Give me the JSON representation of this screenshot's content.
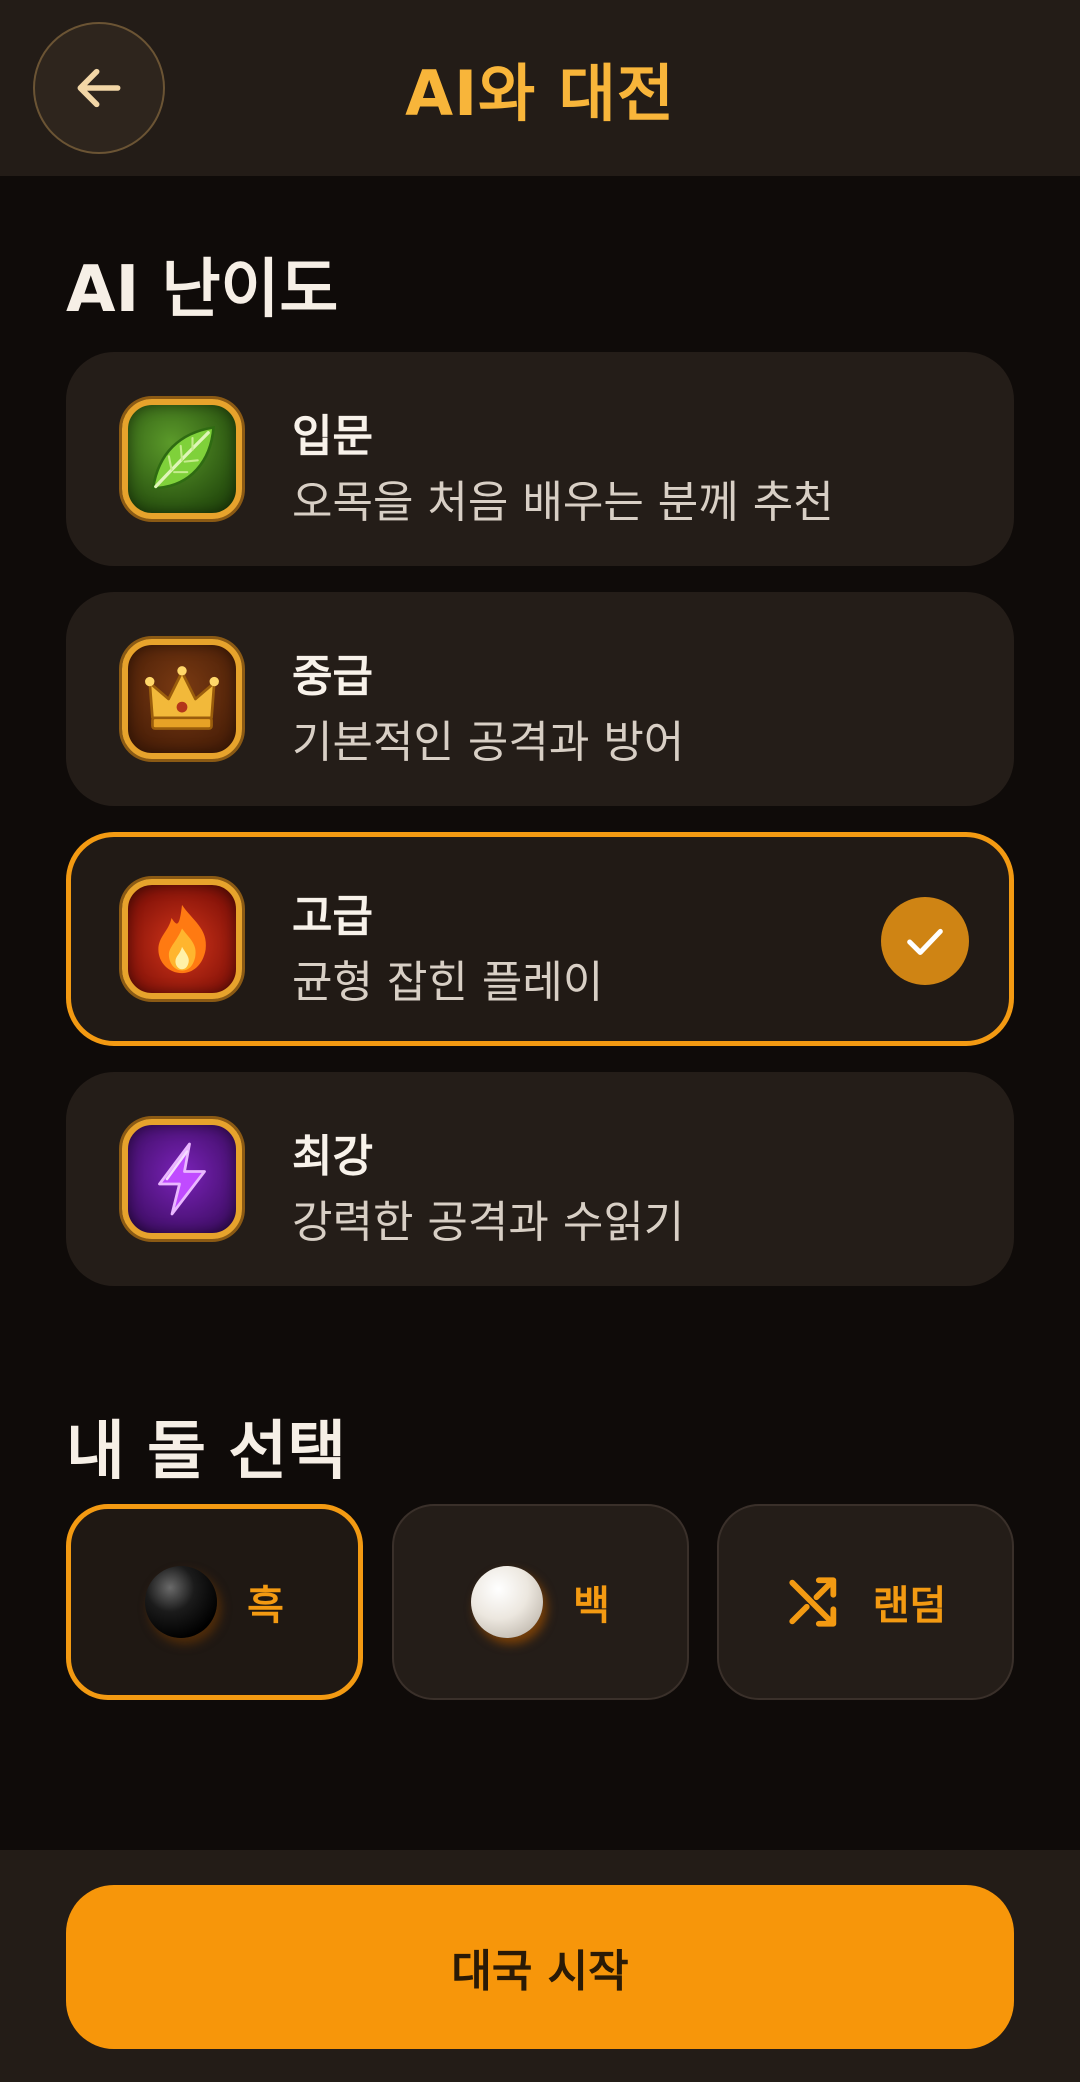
{
  "header": {
    "title": "AI와 대전",
    "back_icon": "arrow-left-icon"
  },
  "difficulty": {
    "section_title": "AI 난이도",
    "options": [
      {
        "title": "입문",
        "desc": "오목을 처음 배우는 분께 추천",
        "icon": "leaf-icon",
        "selected": false
      },
      {
        "title": "중급",
        "desc": "기본적인 공격과 방어",
        "icon": "crown-icon",
        "selected": false
      },
      {
        "title": "고급",
        "desc": "균형 잡힌 플레이",
        "icon": "flame-icon",
        "selected": true
      },
      {
        "title": "최강",
        "desc": "강력한 공격과 수읽기",
        "icon": "lightning-icon",
        "selected": false
      }
    ]
  },
  "stone": {
    "section_title": "내 돌 선택",
    "options": [
      {
        "label": "흑",
        "icon": "black-stone-icon",
        "selected": true
      },
      {
        "label": "백",
        "icon": "white-stone-icon",
        "selected": false
      },
      {
        "label": "랜덤",
        "icon": "shuffle-icon",
        "selected": false
      }
    ]
  },
  "footer": {
    "start_label": "대국 시작"
  },
  "colors": {
    "accent": "#f39a12",
    "background": "#0f0b09",
    "card": "#241d18"
  }
}
